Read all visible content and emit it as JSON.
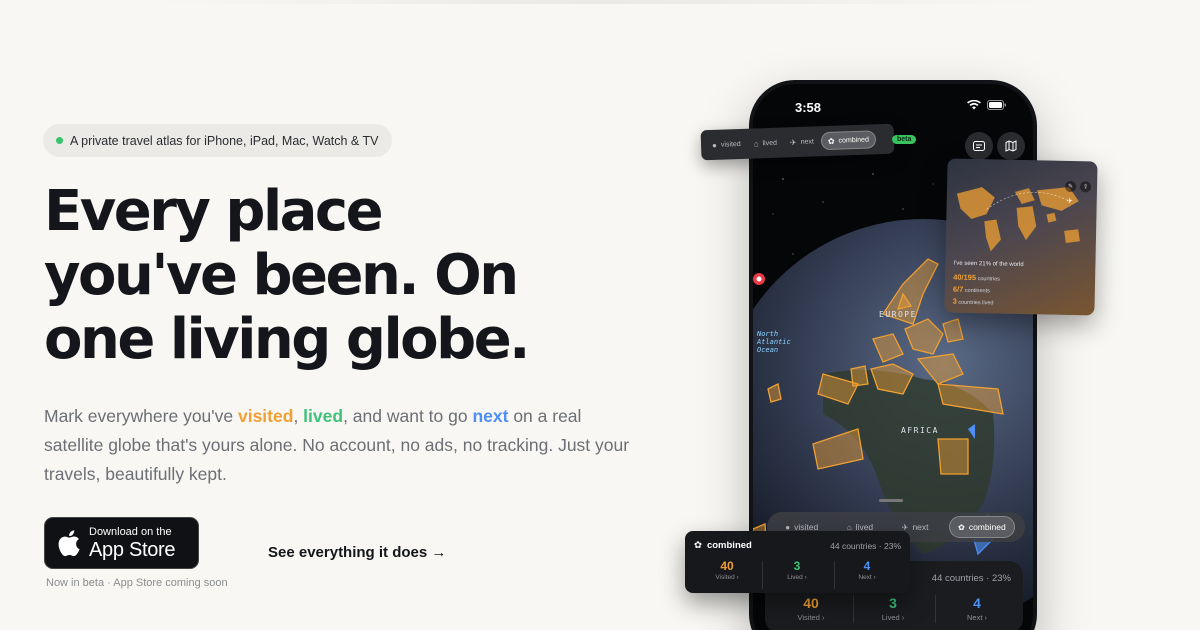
{
  "hero": {
    "pill_text": "A private travel atlas for iPhone, iPad, Mac, Watch & TV",
    "headline": [
      "Every place",
      "you've been. On",
      "one living globe."
    ],
    "subtitle": {
      "part1": "Mark everywhere you've ",
      "visited": "visited",
      "sep1": ", ",
      "lived": "lived",
      "part2": ", and want to go ",
      "next": "next",
      "part3": " on a real satellite globe that's yours alone. No account, no ads, no tracking. Just your travels, beautifully kept."
    },
    "appstore": {
      "small": "Download on the",
      "big": "App Store"
    },
    "beta_note": "Now in beta · App Store coming soon",
    "see_link": "See everything it does →"
  },
  "colors": {
    "visited": "#f0a032",
    "lived": "#3ec27a",
    "next": "#4d8ff5",
    "beta_dot": "#34c46a"
  },
  "phone": {
    "time": "3:58",
    "labels": {
      "europe": "EUROPE",
      "africa": "AFRICA",
      "ocean": [
        "North",
        "Atlantic",
        "Ocean"
      ]
    },
    "modes": [
      {
        "label": "visited",
        "icon": "check-circle-icon"
      },
      {
        "label": "lived",
        "icon": "home-icon"
      },
      {
        "label": "next",
        "icon": "plane-icon"
      },
      {
        "label": "combined",
        "icon": "flower-icon"
      }
    ],
    "card": {
      "count": "44 countries · 23%",
      "visited_num": "40",
      "visited_label": "Visited ›",
      "lived_num": "3",
      "lived_label": "Lived ›",
      "next_num": "4",
      "next_label": "Next ›"
    }
  },
  "float_seg": {
    "modes": [
      "visited",
      "lived",
      "next",
      "combined"
    ],
    "beta": "beta"
  },
  "map_card": {
    "title": "I've seen 21% of the world",
    "countries_num": "40/195",
    "countries_label": "countries",
    "continents_num": "6/7",
    "continents_label": "continents",
    "lived_num": "3",
    "lived_label": "countries lived"
  },
  "combined_card": {
    "title": "combined",
    "count": "44 countries · 23%",
    "visited_num": "40",
    "visited_label": "Visited ›",
    "lived_num": "3",
    "lived_label": "Lived ›",
    "next_num": "4",
    "next_label": "Next ›"
  }
}
